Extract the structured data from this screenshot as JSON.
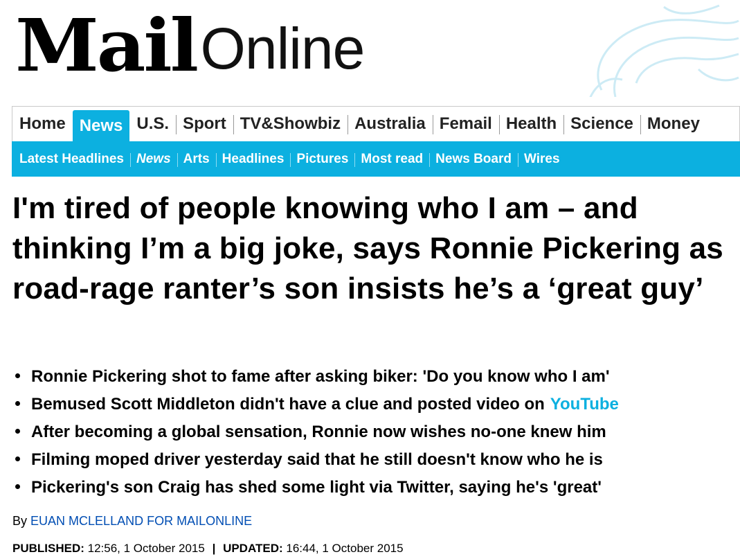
{
  "masthead": {
    "logo_mail": "Mail",
    "logo_online": "Online"
  },
  "nav_primary": [
    "Home",
    "News",
    "U.S.",
    "Sport",
    "TV&Showbiz",
    "Australia",
    "Femail",
    "Health",
    "Science",
    "Money"
  ],
  "nav_primary_active": "News",
  "nav_secondary": [
    "Latest Headlines",
    "News",
    "Arts",
    "Headlines",
    "Pictures",
    "Most read",
    "News Board",
    "Wires"
  ],
  "article": {
    "headline": "I'm tired of people knowing who I am – and thinking I’m a big joke, says Ronnie Pickering as road-rage ranter’s son insists he’s a ‘great guy’",
    "bullets": [
      {
        "text": "Ronnie Pickering shot to fame after asking biker: 'Do you know who I am'"
      },
      {
        "text": "Bemused Scott Middleton didn't have a clue and posted video on",
        "link": "YouTube"
      },
      {
        "text": "After becoming a global sensation, Ronnie now wishes no-one knew him"
      },
      {
        "text": "Filming moped driver yesterday said that he still doesn't know who he is"
      },
      {
        "text": "Pickering's son Craig has shed some light via Twitter, saying he's 'great'"
      }
    ],
    "byline_prefix": "By",
    "author": "EUAN MCLELLAND FOR MAILONLINE",
    "published_label": "PUBLISHED:",
    "published": "12:56, 1 October 2015",
    "separator": "|",
    "updated_label": "UPDATED:",
    "updated": "16:44, 1 October 2015"
  },
  "colors": {
    "accent": "#0cb0e0",
    "author_link": "#004db3"
  }
}
